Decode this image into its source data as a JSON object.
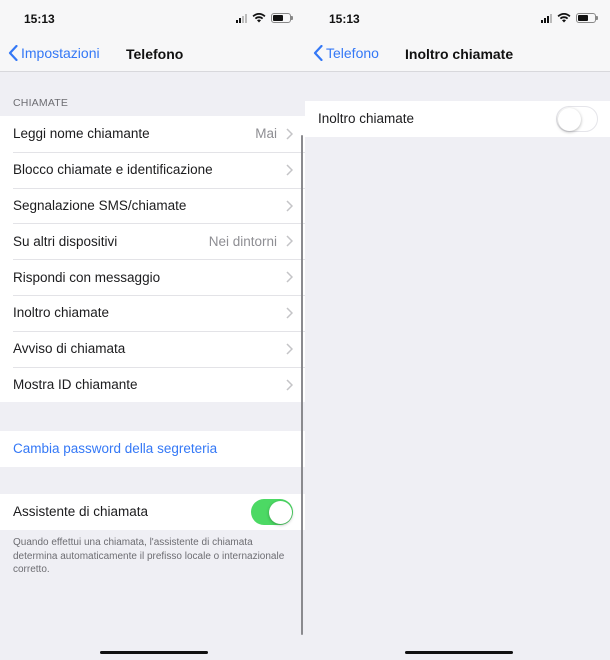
{
  "left_screen": {
    "status_bar": {
      "time": "15:13",
      "icons": [
        "cellular-signal-icon",
        "wifi-icon",
        "battery-icon"
      ]
    },
    "nav": {
      "back_label": "Impostazioni",
      "title": "Telefono"
    },
    "section_header": "CHIAMATE",
    "rows": [
      {
        "label": "Leggi nome chiamante",
        "detail": "Mai"
      },
      {
        "label": "Blocco chiamate e identificazione",
        "detail": ""
      },
      {
        "label": "Segnalazione SMS/chiamate",
        "detail": ""
      },
      {
        "label": "Su altri dispositivi",
        "detail": "Nei dintorni"
      },
      {
        "label": "Rispondi con messaggio",
        "detail": ""
      },
      {
        "label": "Inoltro chiamate",
        "detail": ""
      },
      {
        "label": "Avviso di chiamata",
        "detail": ""
      },
      {
        "label": "Mostra ID chiamante",
        "detail": ""
      }
    ],
    "voicemail_link": "Cambia password della segreteria",
    "dial_assist": {
      "label": "Assistente di chiamata",
      "enabled": true,
      "footer": "Quando effettui una chiamata, l'assistente di chiamata determina automaticamente il prefisso locale o internazionale corretto."
    }
  },
  "right_screen": {
    "status_bar": {
      "time": "15:13",
      "icons": [
        "cellular-signal-icon",
        "wifi-icon",
        "battery-icon"
      ]
    },
    "nav": {
      "back_label": "Telefono",
      "title": "Inoltro chiamate"
    },
    "forwarding": {
      "label": "Inoltro chiamate",
      "enabled": false
    }
  },
  "colors": {
    "accent": "#3478f6",
    "toggle_on": "#4cd964",
    "background": "#efeff4"
  }
}
